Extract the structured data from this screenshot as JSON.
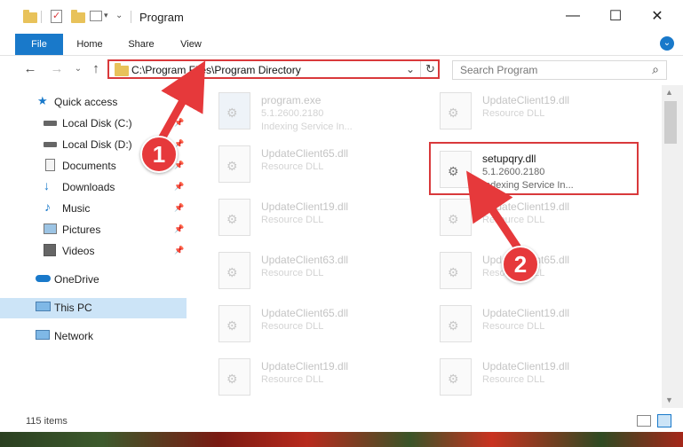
{
  "window": {
    "title": "Program",
    "minimize": "—",
    "maximize": "☐",
    "close": "✕"
  },
  "ribbon": {
    "tabs": [
      "File",
      "Home",
      "Share",
      "View"
    ],
    "expand": "⌄"
  },
  "navigation": {
    "back": "←",
    "forward": "→",
    "recent": "⌄",
    "up": "↑",
    "address_path": "C:\\Program Files\\Program Directory",
    "address_dropdown": "⌄",
    "refresh": "↻",
    "search_placeholder": "Search Program",
    "search_icon": "⌕"
  },
  "sidebar": {
    "items": [
      {
        "label": "Quick access",
        "icon": "star-icon",
        "pinned": false
      },
      {
        "label": "Local Disk (C:)",
        "icon": "drive-icon",
        "pinned": true
      },
      {
        "label": "Local Disk (D:)",
        "icon": "drive-icon",
        "pinned": true
      },
      {
        "label": "Documents",
        "icon": "documents-icon",
        "pinned": true
      },
      {
        "label": "Downloads",
        "icon": "download-icon",
        "pinned": true
      },
      {
        "label": "Music",
        "icon": "music-icon",
        "pinned": true
      },
      {
        "label": "Pictures",
        "icon": "pictures-icon",
        "pinned": true
      },
      {
        "label": "Videos",
        "icon": "videos-icon",
        "pinned": true
      },
      {
        "label": "OneDrive",
        "icon": "cloud-icon",
        "pinned": false
      },
      {
        "label": "This PC",
        "icon": "computer-icon",
        "pinned": false,
        "selected": true
      },
      {
        "label": "Network",
        "icon": "network-icon",
        "pinned": false
      }
    ]
  },
  "files": [
    {
      "name": "program.exe",
      "line2": "5.1.2600.2180",
      "line3": "Indexing Service In..."
    },
    {
      "name": "UpdateClient19.dll",
      "line2": "Resource DLL",
      "line3": ""
    },
    {
      "name": "UpdateClient65.dll",
      "line2": "Resource DLL",
      "line3": ""
    },
    {
      "name": "setupqry.dll",
      "line2": "5.1.2600.2180",
      "line3": "Indexing Service In...",
      "selected": true
    },
    {
      "name": "UpdateClient19.dll",
      "line2": "Resource DLL",
      "line3": ""
    },
    {
      "name": "UpdateClient19.dll",
      "line2": "Resource DLL",
      "line3": ""
    },
    {
      "name": "UpdateClient63.dll",
      "line2": "Resource DLL",
      "line3": ""
    },
    {
      "name": "UpdateClient65.dll",
      "line2": "Resource DLL",
      "line3": ""
    },
    {
      "name": "UpdateClient65.dll",
      "line2": "Resource DLL",
      "line3": ""
    },
    {
      "name": "UpdateClient19.dll",
      "line2": "Resource DLL",
      "line3": ""
    },
    {
      "name": "UpdateClient19.dll",
      "line2": "Resource DLL",
      "line3": ""
    },
    {
      "name": "UpdateClient19.dll",
      "line2": "Resource DLL",
      "line3": ""
    }
  ],
  "status": {
    "item_count": "115 items"
  },
  "callouts": {
    "step1": "1",
    "step2": "2"
  },
  "colors": {
    "accent": "#1979ca",
    "highlight": "#d9393b",
    "selection": "#cce4f7"
  }
}
